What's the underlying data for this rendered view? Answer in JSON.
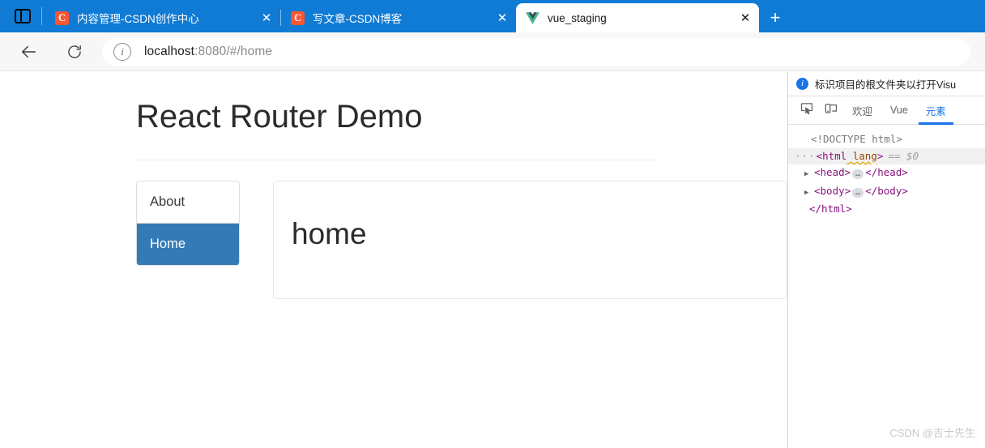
{
  "browser": {
    "tab_search_icon": "split-panel-icon",
    "new_tab_label": "+",
    "close_label": "✕",
    "tabs": [
      {
        "title": "内容管理-CSDN创作中心",
        "favicon": "C",
        "favicon_kind": "csdn",
        "active": false
      },
      {
        "title": "写文章-CSDN博客",
        "favicon": "C",
        "favicon_kind": "csdn",
        "active": false
      },
      {
        "title": "vue_staging",
        "favicon": "vue-logo-icon",
        "favicon_kind": "vue",
        "active": true
      }
    ],
    "toolbar": {
      "back_icon": "back-arrow-icon",
      "reload_icon": "reload-icon",
      "site_info_icon": "info-circle-icon",
      "site_info_glyph": "i",
      "url_host": "localhost",
      "url_rest": ":8080/#/home",
      "url_full": "localhost:8080/#/home"
    }
  },
  "page": {
    "title": "React Router Demo",
    "nav": {
      "items": [
        {
          "label": "About",
          "active": false
        },
        {
          "label": "Home",
          "active": true
        }
      ]
    },
    "content": {
      "heading": "home"
    }
  },
  "devtools": {
    "banner": {
      "icon": "info-circle-icon",
      "glyph": "i",
      "message": "标识项目的根文件夹以打开Visu"
    },
    "toolbar_icons": [
      {
        "name": "inspect-element-icon"
      },
      {
        "name": "device-toolbar-icon"
      }
    ],
    "tabs": [
      {
        "label": "欢迎",
        "active": false
      },
      {
        "label": "Vue",
        "active": false
      },
      {
        "label": "元素",
        "active": true
      }
    ],
    "dom": {
      "doctype": "<!DOCTYPE html>",
      "html_open_prefix": "<",
      "html_tag": "html",
      "html_attr": "lang",
      "html_open_suffix": ">",
      "selected_marker": "== $0",
      "ellipsis": "···",
      "head_open": "<head>",
      "head_close": "</head>",
      "body_open": "<body>",
      "body_close": "</body>",
      "html_close": "</html>",
      "expander": "▶",
      "collapsed_dots": "…"
    }
  },
  "watermark": "CSDN @吉士先生",
  "colors": {
    "browser_blue": "#0f7bd4",
    "accent_blue": "#337ab7",
    "devtools_accent": "#1a73e8",
    "csdn_orange": "#fc5531"
  }
}
